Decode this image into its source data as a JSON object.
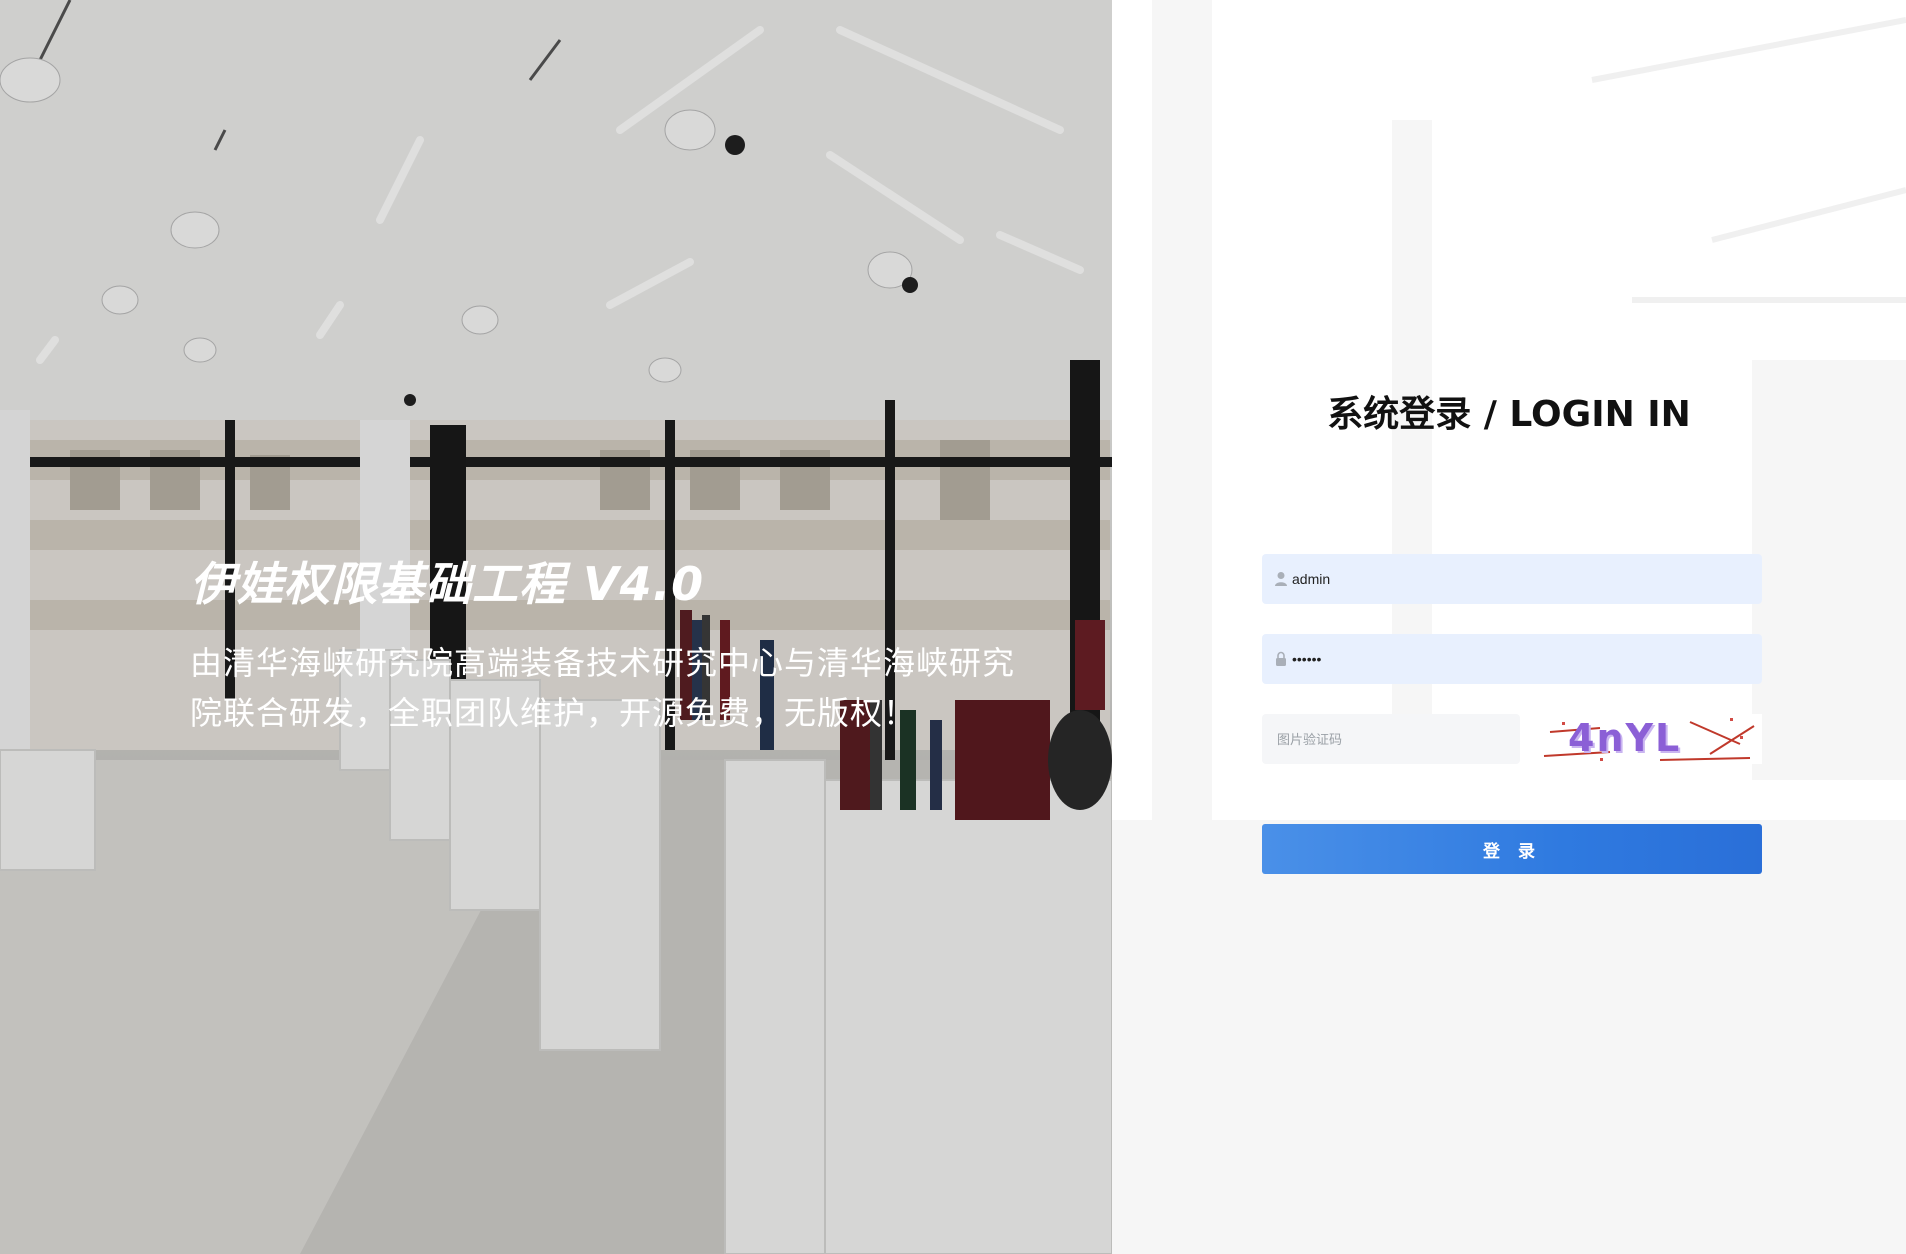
{
  "hero": {
    "title": "伊娃权限基础工程 V4.0",
    "description": "由清华海峡研究院高端装备技术研究中心与清华海峡研究院联合研发，全职团队维护，开源免费，无版权！"
  },
  "login": {
    "title": "系统登录 / LOGIN IN",
    "username": {
      "value": "admin",
      "icon": "user-icon"
    },
    "password": {
      "value": "••••••",
      "icon": "lock-icon"
    },
    "captcha": {
      "placeholder": "图片验证码",
      "image_text": "4nYL"
    },
    "submit_label": "登 录"
  },
  "colors": {
    "button": "#2f7ae0",
    "input_autofill_bg": "#e8f0fe",
    "captcha_text": "#8b5fd6"
  }
}
